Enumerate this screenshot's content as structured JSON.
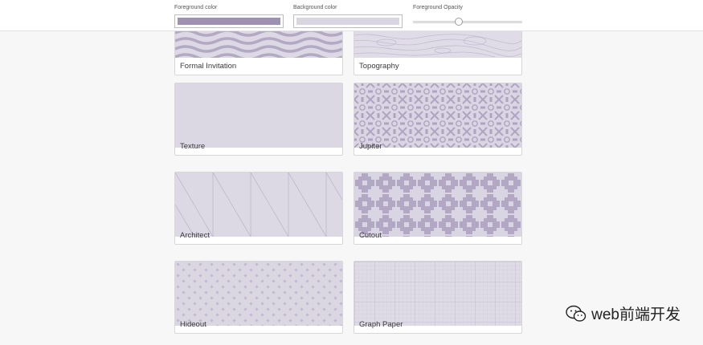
{
  "colors": {
    "foreground": "#9d92b1",
    "background": "#d9d6e2",
    "header_bg": "#ffffff",
    "page_bg": "#f7f7f7"
  },
  "controls": {
    "foreground_label": "Foreground color",
    "background_label": "Background color",
    "opacity_label": "Foreground Opacity",
    "opacity_value": 0.42
  },
  "patterns": [
    {
      "name": "Formal Invitation",
      "icon": "wave-pattern"
    },
    {
      "name": "Topography",
      "icon": "topography-pattern"
    },
    {
      "name": "Texture",
      "icon": "texture-pattern"
    },
    {
      "name": "Jupiter",
      "icon": "jupiter-pattern"
    },
    {
      "name": "Architect",
      "icon": "architect-pattern"
    },
    {
      "name": "Cutout",
      "icon": "cutout-pattern"
    },
    {
      "name": "Hideout",
      "icon": "hideout-pattern"
    },
    {
      "name": "Graph Paper",
      "icon": "graph-paper-pattern"
    }
  ],
  "watermark": {
    "text": "web前端开发",
    "icon": "wechat-icon"
  }
}
